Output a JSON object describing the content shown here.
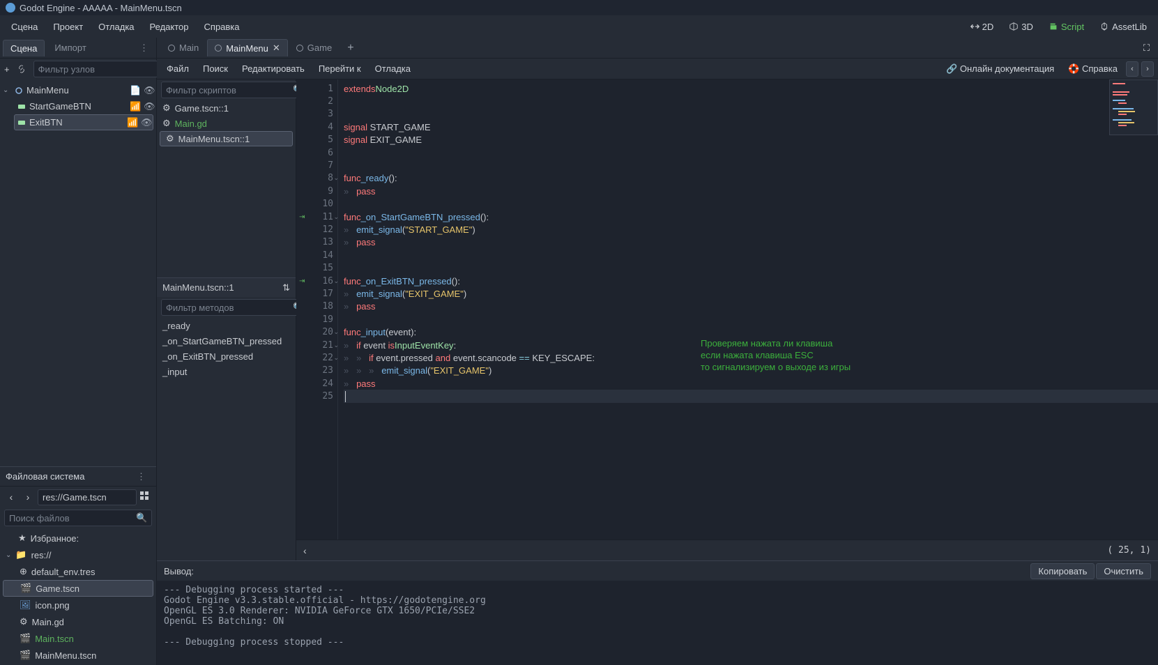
{
  "title": "Godot Engine - AAAAA - MainMenu.tscn",
  "menubar": [
    "Сцена",
    "Проект",
    "Отладка",
    "Редактор",
    "Справка"
  ],
  "modes": {
    "2d": "2D",
    "3d": "3D",
    "script": "Script",
    "assetlib": "AssetLib"
  },
  "scene_panel": {
    "tabs": {
      "scene": "Сцена",
      "import": "Импорт"
    },
    "filter_placeholder": "Фильтр узлов",
    "nodes": [
      {
        "name": "MainMenu",
        "depth": 0,
        "sel": false
      },
      {
        "name": "StartGameBTN",
        "depth": 1,
        "sel": false
      },
      {
        "name": "ExitBTN",
        "depth": 1,
        "sel": true
      }
    ]
  },
  "fs_panel": {
    "title": "Файловая система",
    "path": "res://Game.tscn",
    "search_placeholder": "Поиск файлов",
    "fav": "Избранное:",
    "root": "res://",
    "files": [
      "default_env.tres",
      "Game.tscn",
      "icon.png",
      "Main.gd",
      "Main.tscn",
      "MainMenu.tscn"
    ],
    "selected": "Game.tscn",
    "green": "Main.tscn"
  },
  "scene_tabs": [
    {
      "label": "Main",
      "sel": false,
      "close": false
    },
    {
      "label": "MainMenu",
      "sel": true,
      "close": true
    },
    {
      "label": "Game",
      "sel": false,
      "close": false
    }
  ],
  "script_menu": [
    "Файл",
    "Поиск",
    "Редактировать",
    "Перейти к",
    "Отладка"
  ],
  "script_right": {
    "online": "Онлайн документация",
    "help": "Справка"
  },
  "script_filter_placeholder": "Фильтр скриптов",
  "scripts": [
    {
      "label": "Game.tscn::1",
      "sel": false,
      "green": false
    },
    {
      "label": "Main.gd",
      "sel": false,
      "green": true
    },
    {
      "label": "MainMenu.tscn::1",
      "sel": true,
      "green": false
    }
  ],
  "method_header": "MainMenu.tscn::1",
  "method_filter_placeholder": "Фильтр методов",
  "methods": [
    "_ready",
    "_on_StartGameBTN_pressed",
    "_on_ExitBTN_pressed",
    "_input"
  ],
  "code": {
    "total_lines": 25,
    "folds": [
      8,
      11,
      16,
      20,
      21,
      22
    ],
    "signals": [
      11,
      16
    ],
    "cursor_pos": "( 25,  1)"
  },
  "annotation": [
    "Проверяем нажата ли клавиша",
    "если нажата клавиша ESC",
    "то сигнализируем о выходе из игры"
  ],
  "output": {
    "title": "Вывод:",
    "copy": "Копировать",
    "clear": "Очистить",
    "lines": [
      "--- Debugging process started ---",
      "Godot Engine v3.3.stable.official - https://godotengine.org",
      "OpenGL ES 3.0 Renderer: NVIDIA GeForce GTX 1650/PCIe/SSE2",
      "OpenGL ES Batching: ON",
      "",
      "--- Debugging process stopped ---"
    ]
  }
}
